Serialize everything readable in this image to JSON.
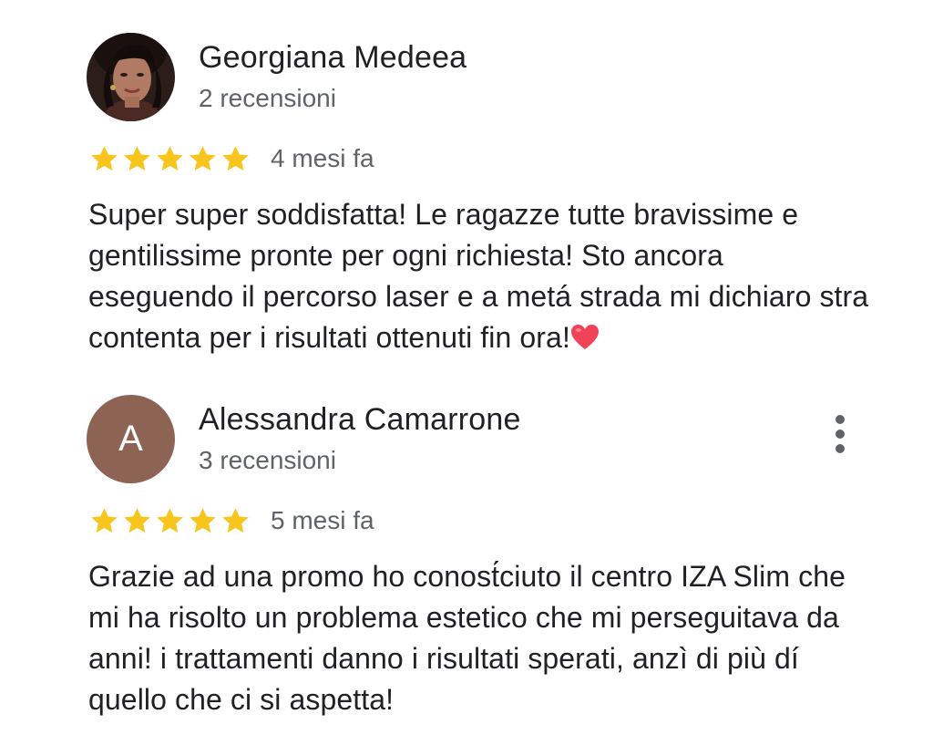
{
  "reviews": [
    {
      "author": "Georgiana Medeea",
      "meta": "2 recensioni",
      "avatar": {
        "type": "photo",
        "description": "profile-photo"
      },
      "rating": 5,
      "date": "4 mesi fa",
      "text": "Super super soddisfatta! Le ragazze tutte bravissime e gentilissime pronte per ogni richiesta! Sto ancora eseguendo il percorso laser e a metá strada mi dichiaro stra contenta per i risultati ottenuti fin ora!",
      "emoji": "heart-icon"
    },
    {
      "author": "Alessandra Camarrone",
      "meta": "3 recensioni",
      "avatar": {
        "type": "letter",
        "letter": "A",
        "color": "#8d6354"
      },
      "rating": 5,
      "date": "5 mesi fa",
      "text": "Grazie ad una promo ho conost́ciuto il centro IZA Slim che mi ha risolto un problema estetico che mi perseguitava da anni! i trattamenti danno i risultati sperati, anzì di più dí quello che ci si aspetta!"
    }
  ],
  "colors": {
    "star": "#f8c51c",
    "text": "#202124",
    "secondary": "#5f6368",
    "heart": "#f0435a"
  }
}
